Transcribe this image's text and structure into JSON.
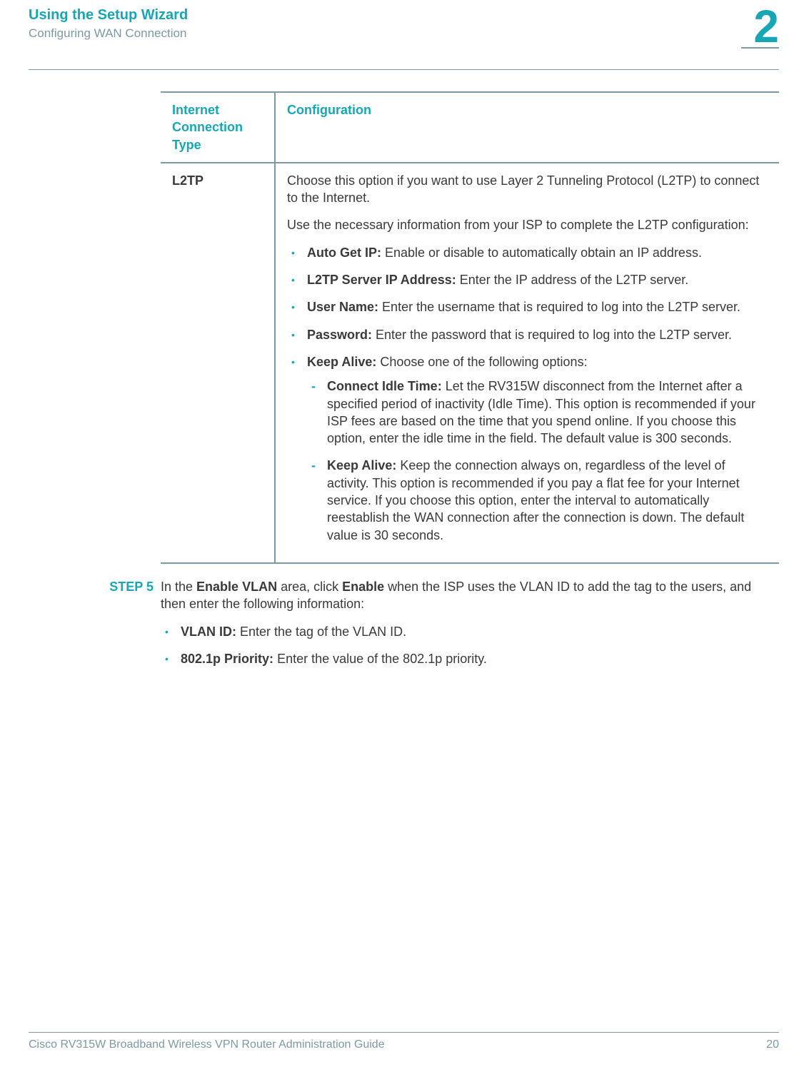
{
  "header": {
    "chapter_title": "Using the Setup Wizard",
    "section_title": "Configuring WAN Connection",
    "chapter_number": "2"
  },
  "table": {
    "headers": {
      "col1": "Internet Connection Type",
      "col2": "Configuration"
    },
    "row": {
      "type": "L2TP",
      "intro1": "Choose this option if you want to use Layer 2 Tunneling Protocol (L2TP) to connect to the Internet.",
      "intro2": "Use the necessary information from your ISP to complete the L2TP configuration:",
      "bullets": [
        {
          "label": "Auto Get IP:",
          "text": " Enable or disable to automatically obtain an IP address."
        },
        {
          "label": "L2TP Server IP Address:",
          "text": " Enter the IP address of the L2TP server."
        },
        {
          "label": "User Name:",
          "text": " Enter the username that is required to log into the L2TP server."
        },
        {
          "label": "Password:",
          "text": " Enter the password that is required to log into the L2TP server."
        },
        {
          "label": "Keep Alive:",
          "text": " Choose one of the following options:"
        }
      ],
      "sub": [
        {
          "label": "Connect Idle Time:",
          "text": " Let the RV315W disconnect from the Internet after a specified period of inactivity (Idle Time). This option is recommended if your ISP fees are based on the time that you spend online. If you choose this option, enter the idle time in the field. The default value is 300 seconds."
        },
        {
          "label": "Keep Alive:",
          "text": " Keep the connection always on, regardless of the level of activity. This option is recommended if you pay a flat fee for your Internet service. If you choose this option, enter the interval to automatically reestablish the WAN connection after the connection is down. The default value is 30 seconds."
        }
      ]
    }
  },
  "step": {
    "label": "STEP  5",
    "intro_pre": "In the ",
    "intro_b1": "Enable VLAN",
    "intro_mid": " area, click ",
    "intro_b2": "Enable",
    "intro_post": " when the ISP uses the VLAN ID to add the tag to the users, and then enter the following information:",
    "bullets": [
      {
        "label": "VLAN ID:",
        "text": " Enter the tag of the VLAN ID."
      },
      {
        "label": "802.1p Priority:",
        "text": " Enter the value of the 802.1p priority."
      }
    ]
  },
  "footer": {
    "left": "Cisco RV315W Broadband Wireless VPN Router Administration Guide",
    "right": "20"
  }
}
